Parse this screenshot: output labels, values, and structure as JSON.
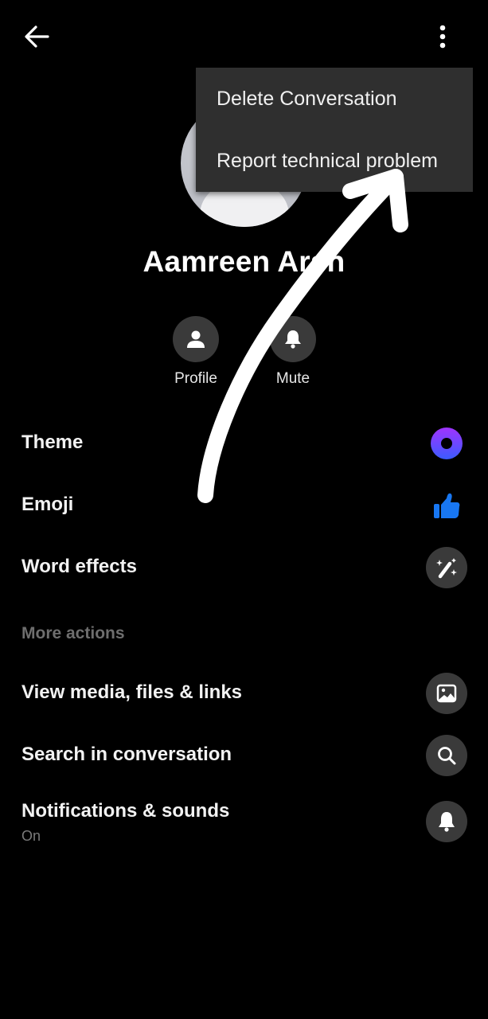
{
  "header": {
    "back_icon": "arrow-left-icon",
    "more_icon": "more-vertical-icon"
  },
  "overflow_menu": {
    "items": [
      {
        "label": "Delete Conversation"
      },
      {
        "label": "Report technical problem"
      }
    ]
  },
  "profile": {
    "name": "Aamreen Arsh",
    "avatar_icon": "default-avatar-icon"
  },
  "quick_actions": [
    {
      "label": "Profile",
      "icon": "person-icon"
    },
    {
      "label": "Mute",
      "icon": "bell-icon"
    }
  ],
  "customization": [
    {
      "label": "Theme",
      "icon": "theme-ring-icon"
    },
    {
      "label": "Emoji",
      "icon": "thumbs-up-icon"
    },
    {
      "label": "Word effects",
      "icon": "magic-wand-icon"
    }
  ],
  "more_actions": {
    "header": "More actions",
    "items": [
      {
        "label": "View media, files & links",
        "icon": "image-icon"
      },
      {
        "label": "Search in conversation",
        "icon": "search-icon"
      },
      {
        "label": "Notifications & sounds",
        "sublabel": "On",
        "icon": "bell-icon"
      }
    ]
  },
  "colors": {
    "background": "#000000",
    "menu_background": "#2f2f2f",
    "icon_circle": "#3a3a3a",
    "emoji_blue": "#1877f2",
    "theme_gradient_start": "#a033ff",
    "theme_gradient_end": "#3b5bff",
    "secondary_text": "#7a7a7a"
  },
  "annotation": {
    "type": "hand-drawn-arrow",
    "points_to": "Report technical problem"
  }
}
